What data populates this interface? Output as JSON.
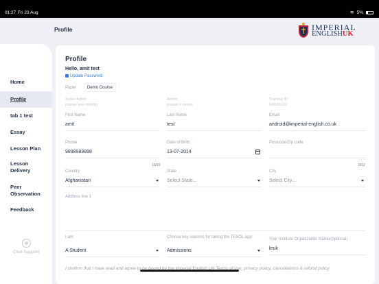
{
  "status_bar": {
    "time": "01:27",
    "date": "Fri 23 Aug",
    "battery": "5%"
  },
  "header": {
    "title": "Profile",
    "logo_line1": "IMPERIAL",
    "logo_line2": "ENGLISH",
    "logo_uk": "UK"
  },
  "sidebar": {
    "items": [
      {
        "label": "Home"
      },
      {
        "label": "Profile",
        "active": true
      },
      {
        "label": "tab 1 test"
      },
      {
        "label": "Essay"
      },
      {
        "label": "Lesson Plan"
      },
      {
        "label": "Lesson Delivery"
      },
      {
        "label": "Peer Observation"
      },
      {
        "label": "Feedback"
      }
    ],
    "chat_support": "Chat Support"
  },
  "profile": {
    "title": "Profile",
    "greeting": "Hello, amit test",
    "update_password": "Update Password",
    "paper_label": "Paper",
    "paper_value": "Demo Course",
    "super_admin_label": "Super Admin",
    "super_admin_value": "pranav test ministry",
    "admin_label": "Admin",
    "admin_value": "pranav 1 centre",
    "training_id_label": "Training ID",
    "training_id_value": "DAN5SCK",
    "first_name_label": "First Name",
    "first_name": "amit",
    "last_name_label": "Last Name",
    "last_name": "test",
    "email_label": "Email",
    "email": "android@imperial-english.co.uk",
    "phone_label": "Phone",
    "phone": "9898989898",
    "phone_count": "10/19",
    "dob_label": "Date of Birth",
    "dob": "13-07-2014",
    "postcode_label": "Postcode/Zip code",
    "postcode": "",
    "postcode_count": "0/12",
    "country_label": "Country",
    "country": "Afghanistan",
    "state_label": "State",
    "state_placeholder": "Select State...",
    "city_label": "City",
    "city_placeholder": "Select City...",
    "address_label": "Address line 1",
    "iam_label": "I am",
    "iam_value": "A Student",
    "reason_label": "Choose key reasons for taking the TESOL app",
    "reason_value": "Admissions",
    "org_label": "Your Institute Organization Name(Optional)",
    "org_value": "leuk",
    "confirm_text": "I confirm that I have read and agree to be bound by the Imperial English UK Terms of use, privacy policy, cancellations & refund policy"
  },
  "colors": {
    "accent": "#3a7bd5",
    "brand_red": "#c8202f",
    "brand_navy": "#1c2f5a"
  },
  "icons": [
    "lock-icon",
    "calendar-icon",
    "chevron-down-icon",
    "chat-icon",
    "wifi-icon",
    "battery-icon"
  ]
}
